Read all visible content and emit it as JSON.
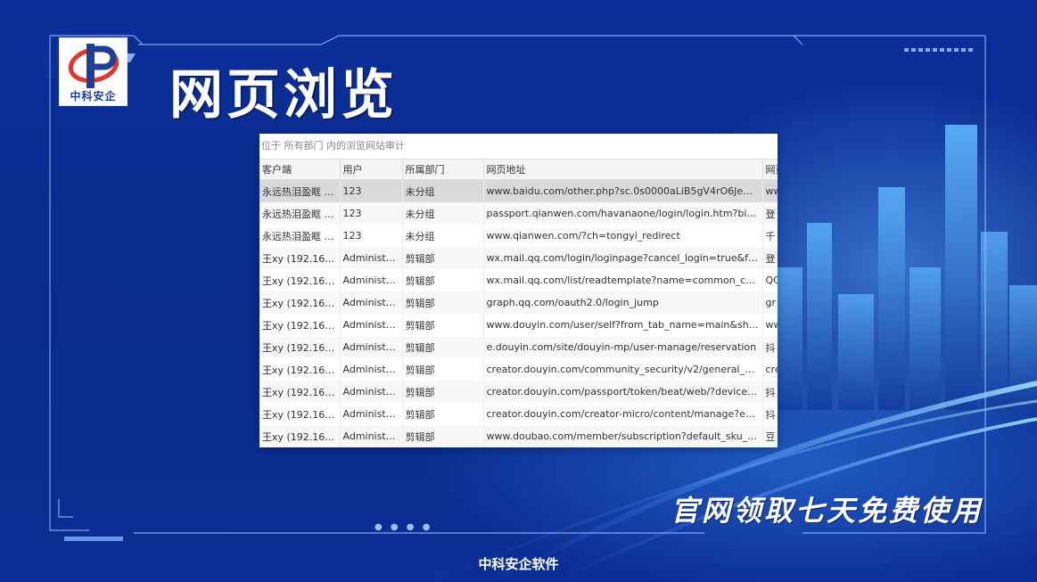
{
  "page_title": "网页浏览",
  "logo": {
    "text": "中科安企"
  },
  "window": {
    "header": "位于 所有部门 内的浏览网站审计",
    "columns": [
      "客户端",
      "用户",
      "所属部门",
      "网页地址",
      "网页"
    ],
    "rows": [
      [
        "永远热泪盈眶 (1...",
        "123",
        "未分组",
        "www.baidu.com/other.php?sc.0s0000aLiB5gV4rO6JeZSBTLR...",
        "ww"
      ],
      [
        "永远热泪盈眶 (1...",
        "123",
        "未分组",
        "passport.qianwen.com/havanaone/login/login.htm?bizPass...",
        "登"
      ],
      [
        "永远热泪盈眶 (1...",
        "123",
        "未分组",
        "www.qianwen.com/?ch=tongyi_redirect",
        "千"
      ],
      [
        "王xy (192.168.3...",
        "Administra...",
        "剪辑部",
        "wx.mail.qq.com/login/loginpage?cancel_login=true&from=...",
        "登"
      ],
      [
        "王xy (192.168.3...",
        "Administra...",
        "剪辑部",
        "wx.mail.qq.com/list/readtemplate?name=common_callback...",
        "QC"
      ],
      [
        "王xy (192.168.3...",
        "Administra...",
        "剪辑部",
        "graph.qq.com/oauth2.0/login_jump",
        "gr"
      ],
      [
        "王xy (192.168.3...",
        "Administra...",
        "剪辑部",
        "www.douyin.com/user/self?from_tab_name=main&showTa...",
        "ww"
      ],
      [
        "王xy (192.168.3...",
        "Administra...",
        "剪辑部",
        "e.douyin.com/site/douyin-mp/user-manage/reservation",
        "抖"
      ],
      [
        "王xy (192.168.3...",
        "Administra...",
        "剪辑部",
        "creator.douyin.com/community_security/v2/general_appeal...",
        "cre"
      ],
      [
        "王xy (192.168.3...",
        "Administra...",
        "剪辑部",
        "creator.douyin.com/passport/token/beat/web/?device_pla...",
        "抖"
      ],
      [
        "王xy (192.168.3...",
        "Administra...",
        "剪辑部",
        "creator.douyin.com/creator-micro/content/manage?enter_f...",
        "抖"
      ],
      [
        "王xy (192.168.3...",
        "Administra...",
        "剪辑部",
        "www.doubao.com/member/subscription?default_sku_key=...",
        "豆"
      ]
    ]
  },
  "slogan": "官网领取七天免费使用",
  "footer": "中科安企软件",
  "colors": {
    "background": "#0a2b8c",
    "accent": "#2f7bff",
    "logo_blue": "#1c3f9a"
  }
}
